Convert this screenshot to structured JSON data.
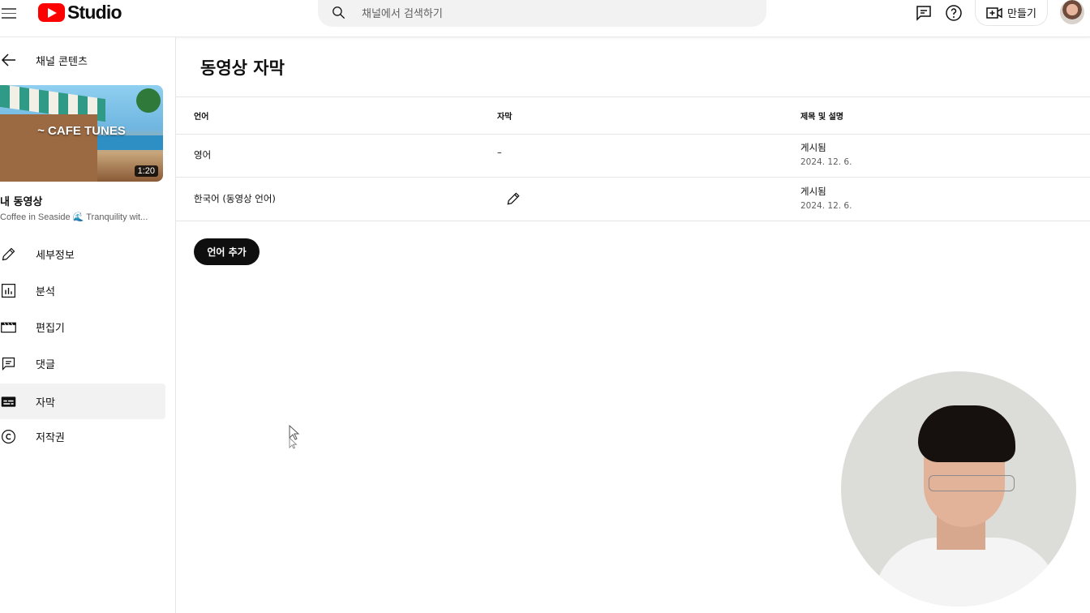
{
  "header": {
    "logo_text": "Studio",
    "search_placeholder": "채널에서 검색하기",
    "create_label": "만들기"
  },
  "sidebar": {
    "back_label": "채널 콘텐츠",
    "thumbnail": {
      "title_text": "~ CAFE TUNES",
      "duration": "1:20"
    },
    "my_video_label": "내 동영상",
    "video_description": "Coffee in Seaside 🌊 Tranquility wit...",
    "items": [
      {
        "label": "세부정보",
        "icon": "pencil-icon",
        "active": false
      },
      {
        "label": "분석",
        "icon": "analytics-icon",
        "active": false
      },
      {
        "label": "편집기",
        "icon": "editor-icon",
        "active": false
      },
      {
        "label": "댓글",
        "icon": "comments-icon",
        "active": false
      },
      {
        "label": "자막",
        "icon": "subtitles-icon",
        "active": true
      },
      {
        "label": "저작권",
        "icon": "copyright-icon",
        "active": false
      }
    ]
  },
  "main": {
    "title": "동영상 자막",
    "table": {
      "headers": [
        "언어",
        "자막",
        "제목 및 설명"
      ],
      "rows": [
        {
          "language": "영어",
          "subtitle": "–",
          "subtitle_icon": "",
          "status": "게시됨",
          "date": "2024. 12. 6."
        },
        {
          "language": "한국어 (동영상 언어)",
          "subtitle": "",
          "subtitle_icon": "pencil-icon",
          "status": "게시됨",
          "date": "2024. 12. 6."
        }
      ]
    },
    "add_language_label": "언어 추가"
  },
  "colors": {
    "accent": "#ff0000",
    "button_bg": "#0f0f0f",
    "active_bg": "#f2f2f2",
    "muted_text": "#606060"
  }
}
